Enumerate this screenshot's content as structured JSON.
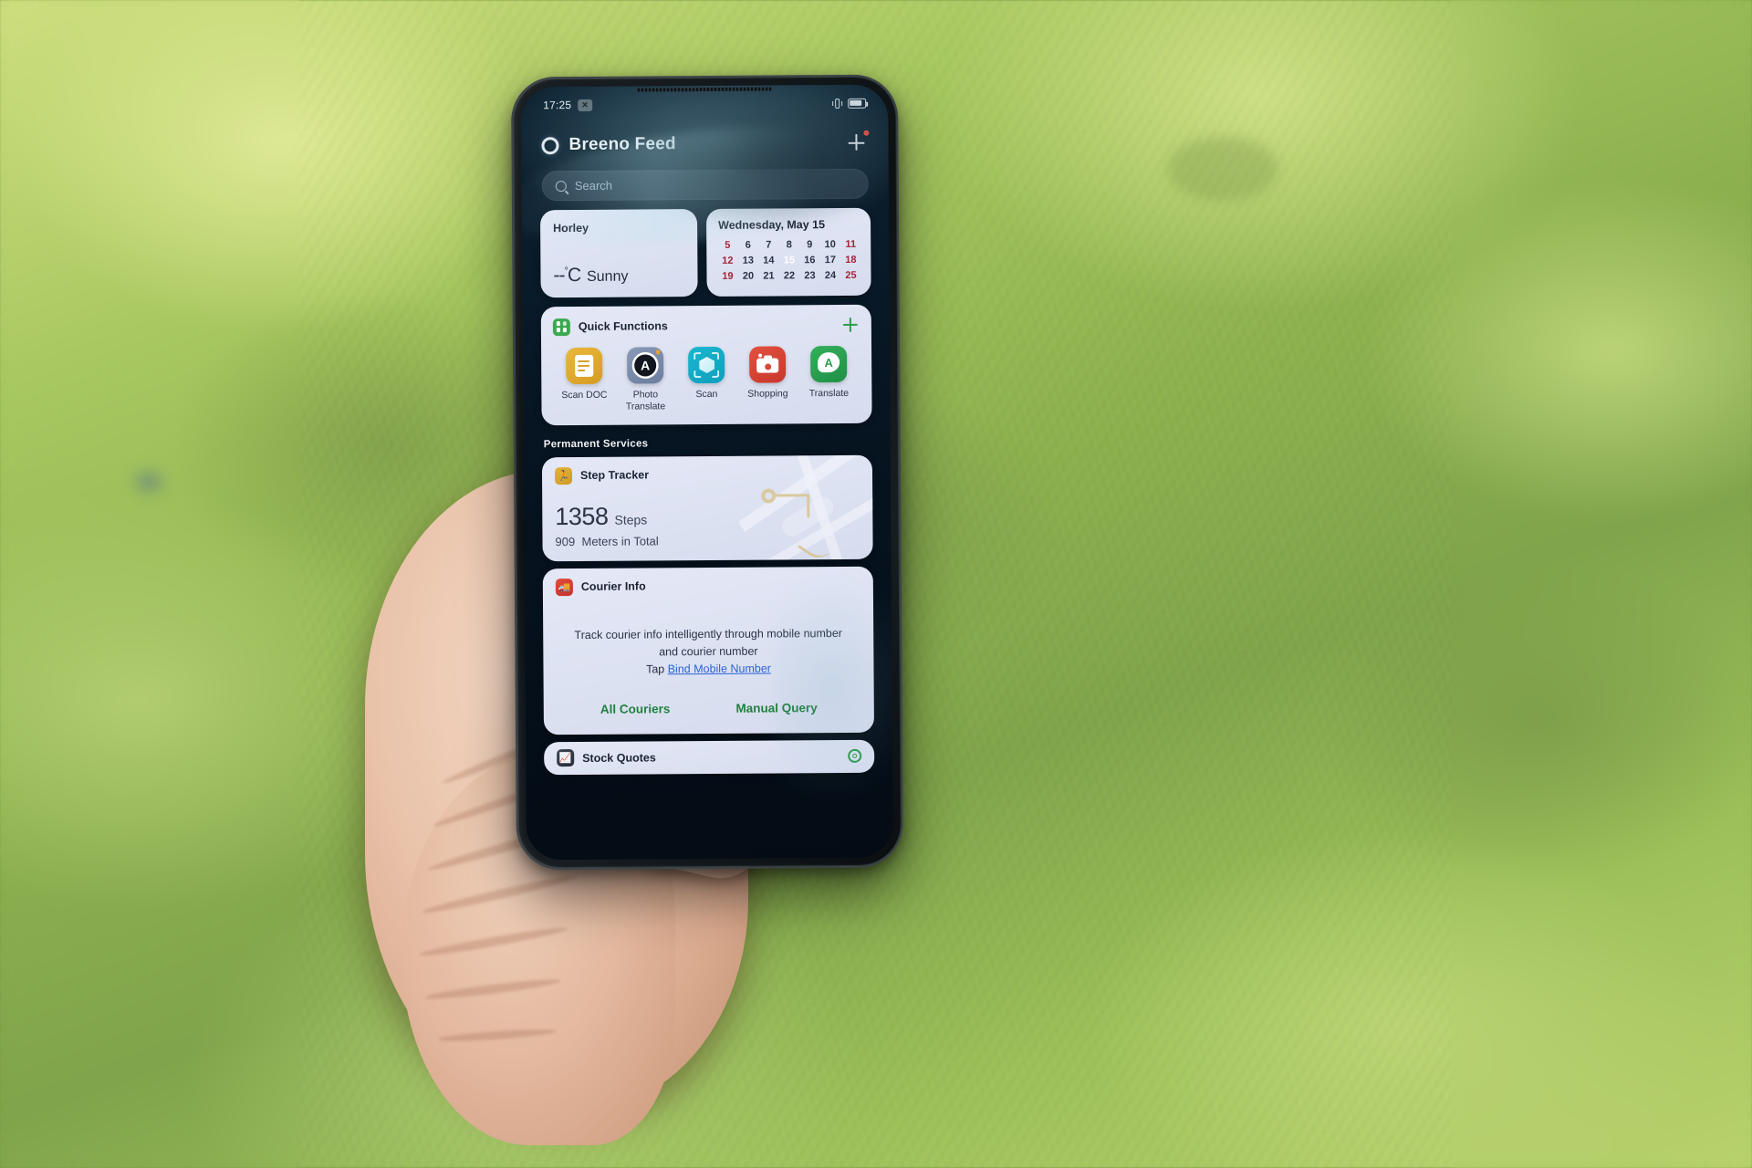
{
  "status_bar": {
    "time": "17:25",
    "chip_icon": "close-chip-icon",
    "vibrate_icon": "vibrate-icon",
    "battery_icon": "battery-icon"
  },
  "app_bar": {
    "logo_icon": "breeno-ring-icon",
    "title": "Breeno Feed",
    "add_icon": "plus-icon",
    "badge_color": "#e8453c"
  },
  "search": {
    "icon": "search-icon",
    "placeholder": "Search"
  },
  "weather": {
    "city": "Horley",
    "temperature": "--",
    "degree": "°",
    "unit": "C",
    "condition": "Sunny"
  },
  "calendar": {
    "title": "Wednesday, May 15",
    "rows": [
      [
        {
          "d": "5",
          "t": "wknd"
        },
        {
          "d": "6",
          "t": ""
        },
        {
          "d": "7",
          "t": ""
        },
        {
          "d": "8",
          "t": ""
        },
        {
          "d": "9",
          "t": ""
        },
        {
          "d": "10",
          "t": ""
        },
        {
          "d": "11",
          "t": "wknd"
        }
      ],
      [
        {
          "d": "12",
          "t": "wknd"
        },
        {
          "d": "13",
          "t": ""
        },
        {
          "d": "14",
          "t": ""
        },
        {
          "d": "15",
          "t": "today"
        },
        {
          "d": "16",
          "t": ""
        },
        {
          "d": "17",
          "t": ""
        },
        {
          "d": "18",
          "t": "wknd"
        }
      ],
      [
        {
          "d": "19",
          "t": "wknd"
        },
        {
          "d": "20",
          "t": ""
        },
        {
          "d": "21",
          "t": ""
        },
        {
          "d": "22",
          "t": ""
        },
        {
          "d": "23",
          "t": ""
        },
        {
          "d": "24",
          "t": ""
        },
        {
          "d": "25",
          "t": "wknd"
        }
      ]
    ],
    "today": "15",
    "today_color": "#b51430",
    "weekend_color": "#a6233a"
  },
  "quick_functions": {
    "title": "Quick Functions",
    "badge_icon": "grid-dots-icon",
    "add_icon": "plus-icon",
    "items": [
      {
        "label": "Scan DOC",
        "icon": "document-scan-icon"
      },
      {
        "label": "Photo\nTranslate",
        "label_l1": "Photo",
        "label_l2": "Translate",
        "icon": "photo-translate-icon"
      },
      {
        "label": "Scan",
        "icon": "cube-scan-icon"
      },
      {
        "label": "Shopping",
        "icon": "camera-shopping-icon"
      },
      {
        "label": "Translate",
        "icon": "translate-bubble-icon"
      }
    ]
  },
  "section": {
    "permanent_services": "Permanent Services"
  },
  "step_tracker": {
    "icon": "walking-person-icon",
    "title": "Step Tracker",
    "steps_value": "1358",
    "steps_unit": "Steps",
    "distance_value": "909",
    "distance_unit": "Meters in Total"
  },
  "courier": {
    "icon": "delivery-truck-icon",
    "title": "Courier Info",
    "desc_line1": "Track courier info intelligently through mobile number",
    "desc_line2": "and courier number",
    "tap_prefix": "Tap ",
    "tap_link": "Bind Mobile Number",
    "link_color": "#2b62d8",
    "action_left": "All Couriers",
    "action_right": "Manual Query",
    "action_color": "#20803f"
  },
  "stock": {
    "icon": "bar-chart-icon",
    "title": "Stock Quotes",
    "settings_icon": "target-gear-icon"
  }
}
